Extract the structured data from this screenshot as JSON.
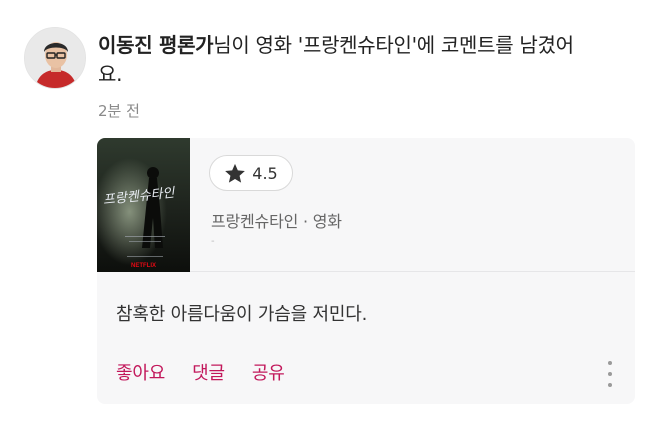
{
  "post": {
    "author": "이동진 평론가",
    "headline_rest": "님이 영화 '프랑켄슈타인'에 코멘트를 남겼어요.",
    "time": "2분 전"
  },
  "movie": {
    "poster_title": "프랑켄슈타인",
    "poster_brand": "NETFLIX",
    "rating": "4.5",
    "meta": "프랑켄슈타인 · 영화",
    "meta_extra": "-"
  },
  "comment": {
    "text": "참혹한 아름다움이 가슴을 저민다."
  },
  "actions": {
    "like_label": "좋아요",
    "comment_label": "댓글",
    "share_label": "공유"
  },
  "icons": {
    "rating": "star-icon",
    "more": "more-vertical-icon"
  },
  "colors": {
    "action": "#c2185b",
    "card_background": "#f7f7f8"
  }
}
